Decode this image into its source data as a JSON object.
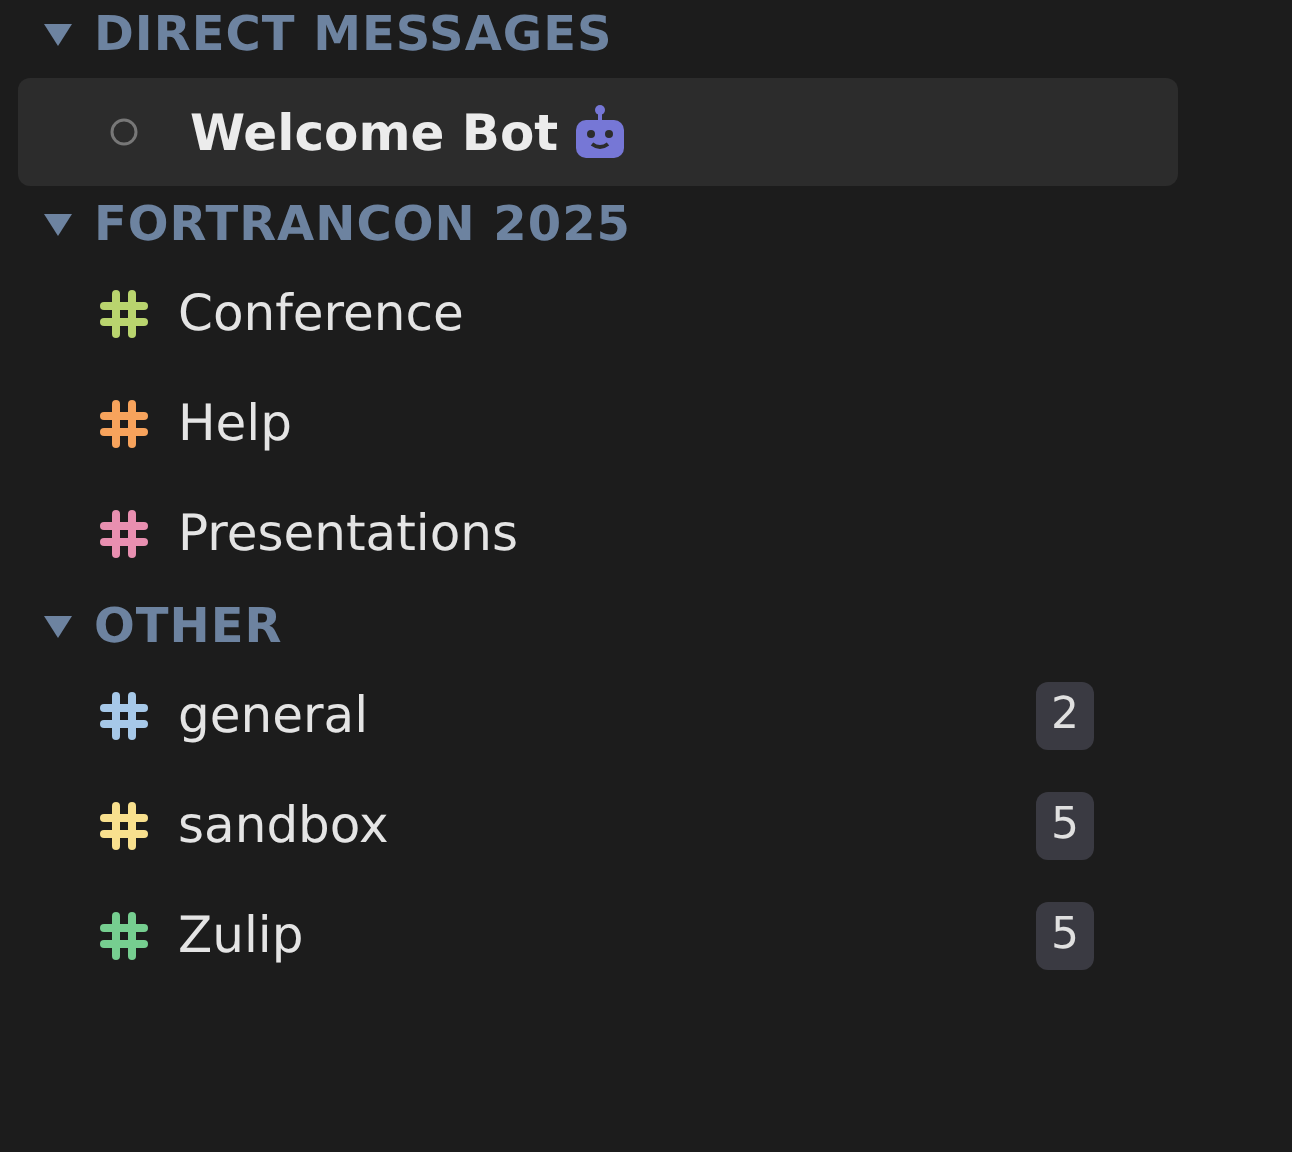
{
  "sections": [
    {
      "title": "DIRECT MESSAGES",
      "expanded": true,
      "items": [
        {
          "kind": "dm",
          "name": "Welcome Bot",
          "bot": true,
          "selected": true
        }
      ]
    },
    {
      "title": "FORTRANCON 2025",
      "expanded": true,
      "items": [
        {
          "kind": "channel",
          "name": "Conference",
          "color": "#b9d46e",
          "selected": false
        },
        {
          "kind": "channel",
          "name": "Help",
          "color": "#f7a35c",
          "selected": false
        },
        {
          "kind": "channel",
          "name": "Presentations",
          "color": "#e88fb0",
          "selected": false
        }
      ]
    },
    {
      "title": "OTHER",
      "expanded": true,
      "items": [
        {
          "kind": "channel",
          "name": "general",
          "color": "#a6c8e8",
          "selected": false,
          "unread": "2"
        },
        {
          "kind": "channel",
          "name": "sandbox",
          "color": "#f8e08e",
          "selected": false,
          "unread": "5"
        },
        {
          "kind": "channel",
          "name": "Zulip",
          "color": "#76ce90",
          "selected": false,
          "unread": "5"
        }
      ]
    }
  ]
}
